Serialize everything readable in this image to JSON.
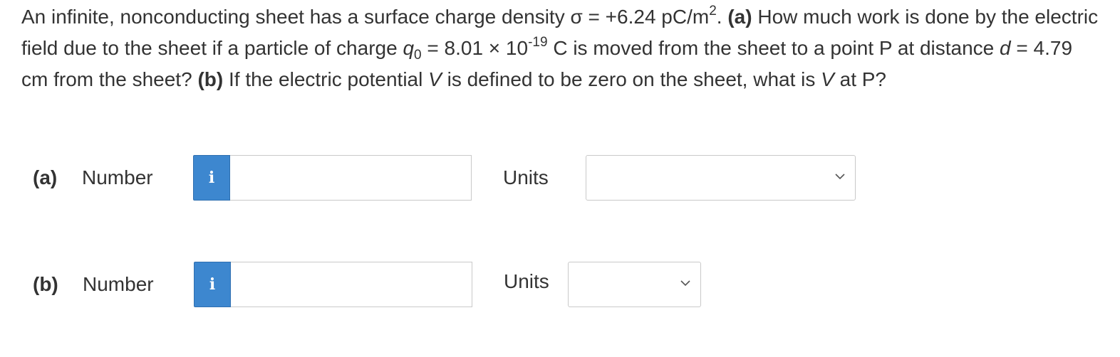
{
  "question": {
    "intro_1": "An infinite, nonconducting sheet has a surface charge density σ = +6.24 pC/m",
    "sigma_exp": "2",
    "intro_2": ". ",
    "part_a_marker": "(a)",
    "text_a_1": " How much work is done by the electric field due to the sheet if a particle of charge ",
    "q_symbol": "q",
    "q_sub": "0",
    "text_a_2": " = 8.01 × 10",
    "q_exp": "-19",
    "text_a_3": " C is moved from the sheet to a point P at distance ",
    "d_symbol": "d",
    "text_a_4": " = 4.79 cm from the sheet? ",
    "part_b_marker": "(b)",
    "text_b_1": " If the electric potential ",
    "v_symbol_1": "V",
    "text_b_2": " is defined to be zero on the sheet, what is ",
    "v_symbol_2": "V",
    "text_b_3": " at P?"
  },
  "answers": {
    "a": {
      "part_label": "(a)",
      "number_label": "Number",
      "info_icon": "i",
      "number_value": "",
      "units_label": "Units",
      "units_value": ""
    },
    "b": {
      "part_label": "(b)",
      "number_label": "Number",
      "info_icon": "i",
      "number_value": "",
      "units_label": "Units",
      "units_value": ""
    }
  },
  "colors": {
    "info_button": "#3d87cf",
    "text": "#333333",
    "border": "#c9c9c9"
  },
  "icons": {
    "info": "info-icon",
    "dropdown": "chevron-down-icon"
  }
}
